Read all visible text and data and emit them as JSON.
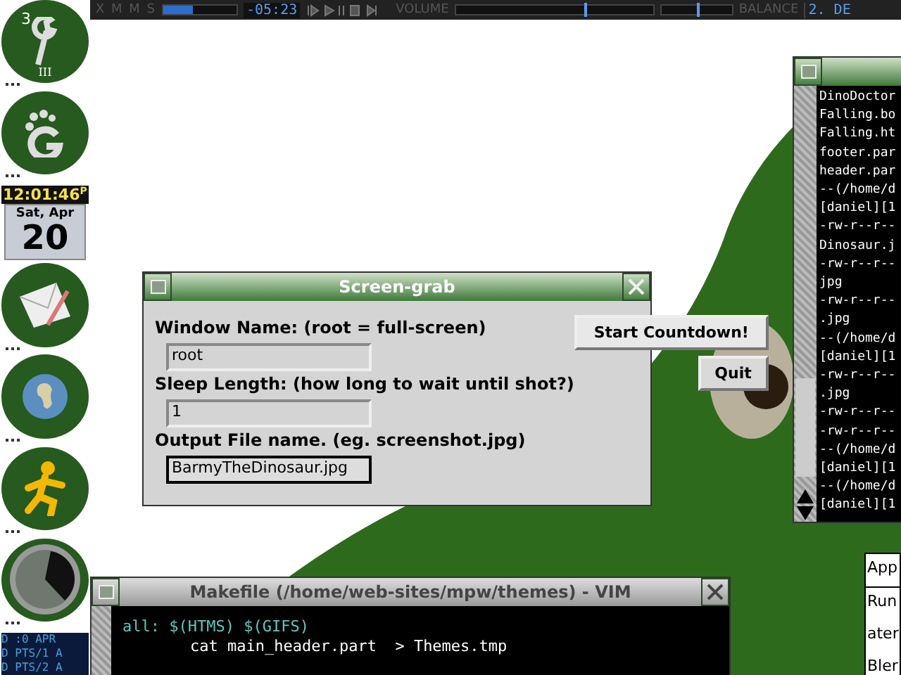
{
  "xmms": {
    "title": "X M M S",
    "time": "-05:23",
    "position": {
      "level": 0.4
    },
    "volume_label": "VOLUME",
    "volume": {
      "level": 0.65
    },
    "balance": {
      "level": 0.5
    },
    "balance_label": "BALANCE",
    "track": "2. DE"
  },
  "dock": [
    {
      "kind": "wrench",
      "badge": "3",
      "caption": "III"
    },
    {
      "kind": "foot"
    },
    {
      "kind": "clock",
      "time": "12:01:46",
      "suffix": "P",
      "day": "Sat, Apr",
      "date": "20"
    },
    {
      "kind": "mail"
    },
    {
      "kind": "globe"
    },
    {
      "kind": "runner"
    },
    {
      "kind": "radar"
    },
    {
      "kind": "monitor",
      "lines": [
        "D :0 APR",
        "D PTS/1 A",
        "D PTS/2 A"
      ]
    }
  ],
  "terminal": {
    "lines": [
      "DinoDoctor",
      "Falling.bo",
      "Falling.ht",
      "footer.par",
      "header.par",
      "--(/home/d",
      "[daniel][1",
      "-rw-r--r--",
      "Dinosaur.j",
      "-rw-r--r--",
      "jpg",
      "-rw-r--r--",
      ".jpg",
      "--(/home/d",
      "[daniel][1",
      "-rw-r--r--",
      ".jpg",
      "-rw-r--r--",
      "-rw-r--r--",
      "--(/home/d",
      "[daniel][1",
      "--(/home/d",
      "[daniel][1"
    ]
  },
  "screen_grab": {
    "title": "Screen-grab",
    "fields": [
      {
        "label": "Window Name: (root = full-screen)",
        "value": "root",
        "focused": false
      },
      {
        "label": "Sleep Length: (how long to wait until shot?)",
        "value": "1",
        "focused": false
      },
      {
        "label": "Output File name. (eg. screenshot.jpg)",
        "value": "BarmyTheDinosaur.jpg",
        "focused": true
      }
    ],
    "buttons": [
      "Start Countdown!",
      "Quit"
    ]
  },
  "vim": {
    "title": "Makefile (/home/web-sites/mpw/themes) - VIM",
    "lines": [
      {
        "kind": "target",
        "text": "all: $(HTMS) $(GIFS)"
      },
      {
        "kind": "command",
        "text": "cat main_header.part  > Themes.tmp"
      }
    ]
  },
  "menu": {
    "items": [
      {
        "label": "App",
        "selected": false
      },
      {
        "label": "Run",
        "selected": false
      },
      {
        "label": "ater",
        "selected": false
      },
      {
        "label": "Bler",
        "selected": false
      }
    ]
  }
}
